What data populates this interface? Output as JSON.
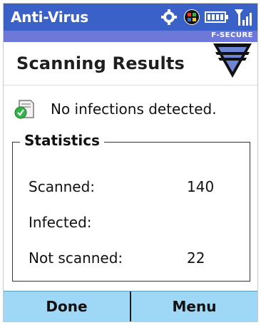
{
  "titlebar": {
    "app_title": "Anti-Virus",
    "icons": [
      "sync-icon",
      "windows-flag-icon",
      "battery-icon",
      "signal-icon"
    ]
  },
  "brand": {
    "text": "F-SECURE"
  },
  "page": {
    "title": "Scanning Results"
  },
  "result": {
    "icon": "clean-document-check-icon",
    "message": "No infections detected."
  },
  "stats": {
    "legend": "Statistics",
    "rows": [
      {
        "label": "Scanned:",
        "value": "140"
      },
      {
        "label": "Infected:",
        "value": ""
      },
      {
        "label": "Not scanned:",
        "value": "22"
      }
    ]
  },
  "softkeys": {
    "left": "Done",
    "right": "Menu"
  },
  "colors": {
    "titlebar": "#3a61c7",
    "brand_strip": "#6e78d8",
    "softkey_bar": "#9ed8f6",
    "logo_blue": "#6f86d6"
  }
}
